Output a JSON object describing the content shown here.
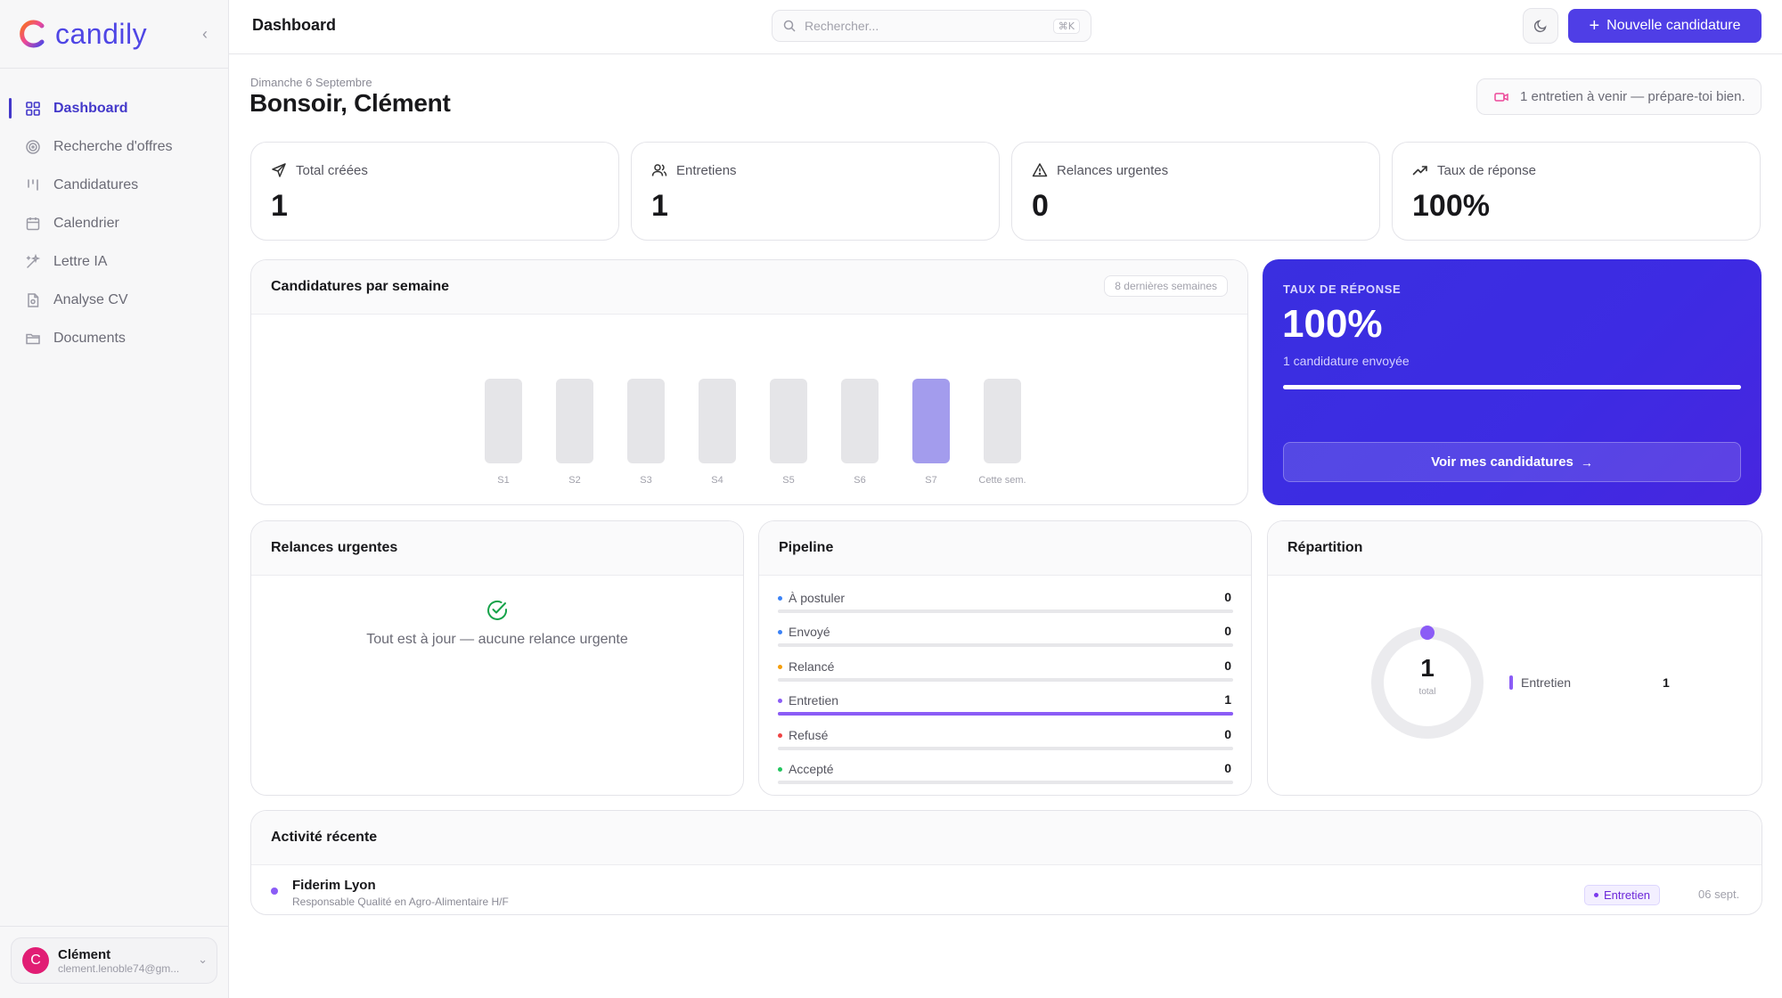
{
  "brand": {
    "name": "candily"
  },
  "sidebar": {
    "collapse": "‹",
    "items": [
      {
        "label": "Dashboard",
        "icon": "grid-icon",
        "active": true
      },
      {
        "label": "Recherche d'offres",
        "icon": "radar-icon"
      },
      {
        "label": "Candidatures",
        "icon": "kanban-icon"
      },
      {
        "label": "Calendrier",
        "icon": "calendar-icon"
      },
      {
        "label": "Lettre IA",
        "icon": "sparkles-icon"
      },
      {
        "label": "Analyse CV",
        "icon": "file-icon"
      },
      {
        "label": "Documents",
        "icon": "folder-icon"
      }
    ],
    "user": {
      "initial": "C",
      "name": "Clément",
      "email": "clement.lenoble74@gm..."
    }
  },
  "header": {
    "title": "Dashboard",
    "search_placeholder": "Rechercher...",
    "search_shortcut": "⌘K",
    "new_button": "Nouvelle candidature"
  },
  "greeting": {
    "date": "Dimanche 6 Septembre",
    "title": "Bonsoir, Clément",
    "notice": "1 entretien à venir — prépare-toi bien."
  },
  "stats": [
    {
      "label": "Total créées",
      "value": "1",
      "icon": "send-icon"
    },
    {
      "label": "Entretiens",
      "value": "1",
      "icon": "users-icon"
    },
    {
      "label": "Relances urgentes",
      "value": "0",
      "icon": "warning-icon"
    },
    {
      "label": "Taux de réponse",
      "value": "100%",
      "icon": "trending-up-icon"
    }
  ],
  "weekly": {
    "title": "Candidatures par semaine",
    "range": "8 dernières semaines"
  },
  "chart_data": {
    "type": "bar",
    "categories": [
      "S1",
      "S2",
      "S3",
      "S4",
      "S5",
      "S6",
      "S7",
      "Cette sem."
    ],
    "values": [
      0,
      0,
      0,
      0,
      0,
      0,
      1,
      0
    ],
    "highlight_index": 6,
    "colors": {
      "bar": "#e5e5e8",
      "highlight": "#a39ced"
    }
  },
  "rate": {
    "label": "TAUX DE RÉPONSE",
    "value": "100%",
    "sub": "1 candidature envoyée",
    "progress": 1.0,
    "button": "Voir mes candidatures",
    "arrow": "→"
  },
  "relances": {
    "title": "Relances urgentes",
    "empty": "Tout est à jour — aucune relance urgente"
  },
  "pipeline": {
    "title": "Pipeline",
    "rows": [
      {
        "name": "À postuler",
        "count": "0",
        "color": "#3b82f6",
        "fill": 0
      },
      {
        "name": "Envoyé",
        "count": "0",
        "color": "#3b82f6",
        "fill": 0
      },
      {
        "name": "Relancé",
        "count": "0",
        "color": "#f59e0b",
        "fill": 0
      },
      {
        "name": "Entretien",
        "count": "1",
        "color": "#8b5cf6",
        "fill": 1
      },
      {
        "name": "Refusé",
        "count": "0",
        "color": "#ef4444",
        "fill": 0
      },
      {
        "name": "Accepté",
        "count": "0",
        "color": "#22c55e",
        "fill": 0
      }
    ]
  },
  "repartition": {
    "title": "Répartition",
    "total": "1",
    "total_label": "total",
    "legend": [
      {
        "name": "Entretien",
        "count": "1",
        "color": "#8b5cf6"
      }
    ]
  },
  "activity": {
    "title": "Activité récente",
    "items": [
      {
        "company": "Fiderim Lyon",
        "role": "Responsable Qualité en Agro-Alimentaire H/F",
        "status": "Entretien",
        "date": "06 sept."
      }
    ]
  },
  "colors": {
    "accent": "#4f3ee6",
    "active_nav": "#4338ca",
    "success": "#16a34a"
  }
}
